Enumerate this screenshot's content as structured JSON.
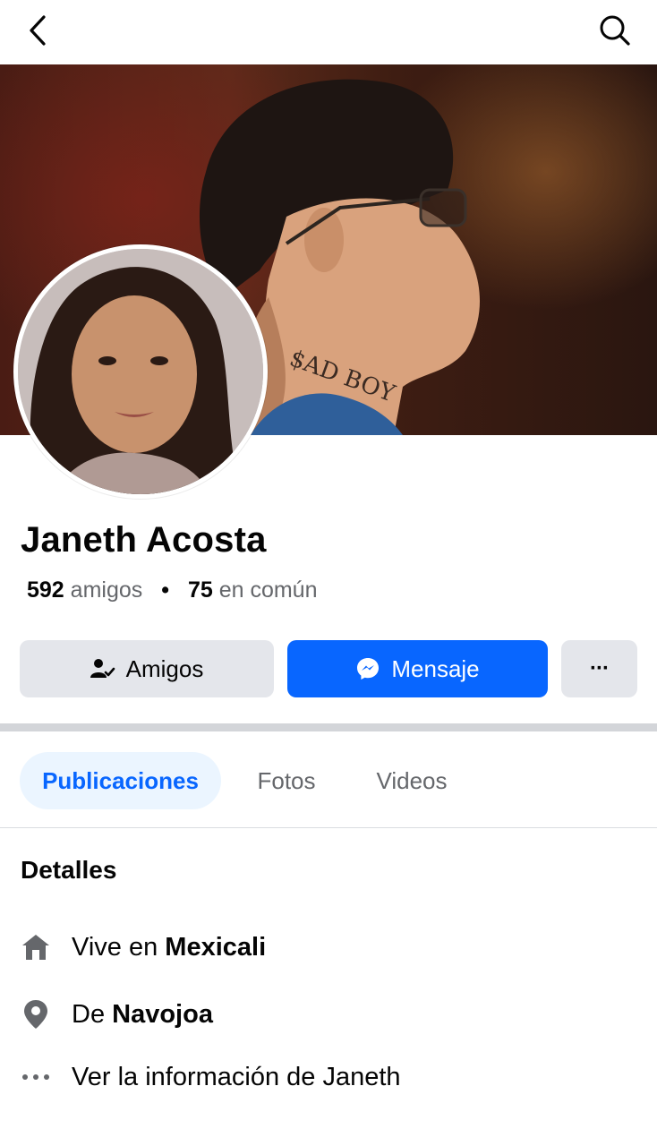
{
  "profile": {
    "name": "Janeth Acosta",
    "friends_count": "592",
    "friends_label": "amigos",
    "mutual_count": "75",
    "mutual_label": "en común"
  },
  "actions": {
    "friends_label": "Amigos",
    "message_label": "Mensaje",
    "more_label": "···"
  },
  "tabs": [
    {
      "label": "Publicaciones",
      "active": true
    },
    {
      "label": "Fotos",
      "active": false
    },
    {
      "label": "Videos",
      "active": false
    }
  ],
  "details": {
    "title": "Detalles",
    "lives_prefix": "Vive en",
    "lives_city": "Mexicali",
    "from_prefix": "De",
    "from_city": "Navojoa",
    "see_more": "Ver la información de Janeth"
  },
  "icons": {
    "back": "back-arrow-icon",
    "search": "search-icon",
    "friends": "friends-check-icon",
    "messenger": "messenger-icon",
    "home": "home-icon",
    "location": "location-pin-icon",
    "more": "more-dots-icon"
  },
  "colors": {
    "primary_blue": "#0866ff",
    "button_gray": "#e4e6eb",
    "tab_active_bg": "#ebf5ff",
    "secondary_text": "#65676b"
  }
}
